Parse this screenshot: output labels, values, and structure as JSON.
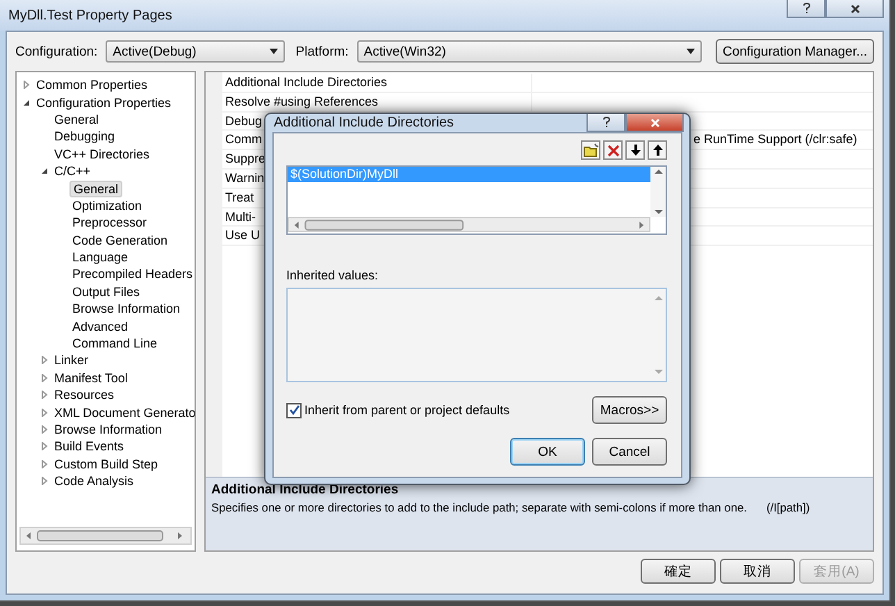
{
  "window": {
    "title": "MyDll.Test Property Pages"
  },
  "toolbar": {
    "configuration_label": "Configuration:",
    "configuration": "Active(Debug)",
    "platform_label": "Platform:",
    "platform": "Active(Win32)",
    "manager_button": "Configuration Manager..."
  },
  "tree": [
    {
      "label": "Common Properties",
      "expanded": false,
      "selected": false
    },
    {
      "label": "Configuration Properties",
      "expanded": true,
      "selected": false,
      "children": [
        {
          "label": "General",
          "selected": false
        },
        {
          "label": "Debugging",
          "selected": false
        },
        {
          "label": "VC++ Directories",
          "selected": false
        },
        {
          "label": "C/C++",
          "expanded": true,
          "selected": false,
          "children": [
            {
              "label": "General",
              "selected": true
            },
            {
              "label": "Optimization",
              "selected": false
            },
            {
              "label": "Preprocessor",
              "selected": false
            },
            {
              "label": "Code Generation",
              "selected": false
            },
            {
              "label": "Language",
              "selected": false
            },
            {
              "label": "Precompiled Headers",
              "selected": false
            },
            {
              "label": "Output Files",
              "selected": false
            },
            {
              "label": "Browse Information",
              "selected": false
            },
            {
              "label": "Advanced",
              "selected": false
            },
            {
              "label": "Command Line",
              "selected": false
            }
          ]
        },
        {
          "label": "Linker",
          "expanded": false,
          "selected": false
        },
        {
          "label": "Manifest Tool",
          "expanded": false,
          "selected": false
        },
        {
          "label": "Resources",
          "expanded": false,
          "selected": false
        },
        {
          "label": "XML Document Generato",
          "expanded": false,
          "selected": false
        },
        {
          "label": "Browse Information",
          "expanded": false,
          "selected": false
        },
        {
          "label": "Build Events",
          "expanded": false,
          "selected": false
        },
        {
          "label": "Custom Build Step",
          "expanded": false,
          "selected": false
        },
        {
          "label": "Code Analysis",
          "expanded": false,
          "selected": false
        }
      ]
    }
  ],
  "grid": [
    {
      "name": "Additional Include Directories"
    },
    {
      "name": "Resolve #using References"
    },
    {
      "name": "Debug"
    },
    {
      "name": "Comm",
      "value": "e RunTime Support (/clr:safe)"
    },
    {
      "name": "Suppre"
    },
    {
      "name": "Warnin"
    },
    {
      "name": "Treat"
    },
    {
      "name": "Multi-"
    },
    {
      "name": "Use U"
    }
  ],
  "description": {
    "title": "Additional Include Directories",
    "text": "Specifies one or more directories to add to the include path; separate with semi-colons if more than one.",
    "switch": "(/I[path])"
  },
  "footer_buttons": [
    {
      "label": "確定",
      "disabled": false
    },
    {
      "label": "取消",
      "disabled": false
    },
    {
      "label": "套用(A)",
      "disabled": true
    }
  ],
  "dialog": {
    "title": "Additional Include Directories",
    "items": [
      {
        "text": "$(SolutionDir)MyDll",
        "selected": true
      }
    ],
    "inherited_label": "Inherited values:",
    "inherit": {
      "label": "Inherit from parent or project defaults",
      "checked": true
    },
    "macros_button": "Macros>>",
    "ok_button": "OK",
    "cancel_button": "Cancel"
  }
}
